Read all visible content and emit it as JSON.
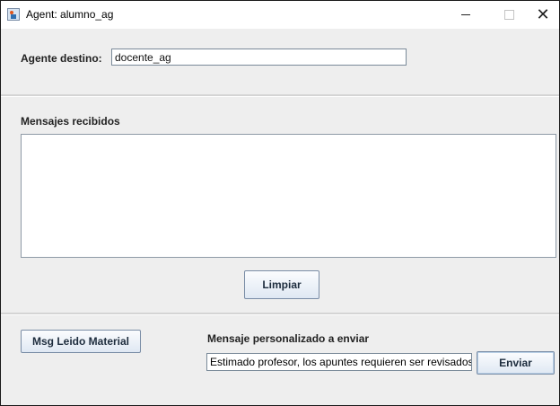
{
  "window": {
    "title": "Agent: alumno_ag",
    "controls": {
      "minimize": "—",
      "maximize": "☐",
      "close": "✕"
    }
  },
  "destino": {
    "label": "Agente destino:",
    "value": "docente_ag"
  },
  "mensajes": {
    "label": "Mensajes recibidos",
    "content": ""
  },
  "buttons": {
    "limpiar": "Limpiar",
    "msg_leido": "Msg Leido Material",
    "enviar": "Enviar"
  },
  "personalizado": {
    "label": "Mensaje personalizado a enviar",
    "value": "Estimado profesor, los apuntes requieren ser revisados"
  },
  "icons": {
    "app": "java-app-icon",
    "minimize": "minimize-icon",
    "maximize": "maximize-icon",
    "close": "close-icon"
  }
}
